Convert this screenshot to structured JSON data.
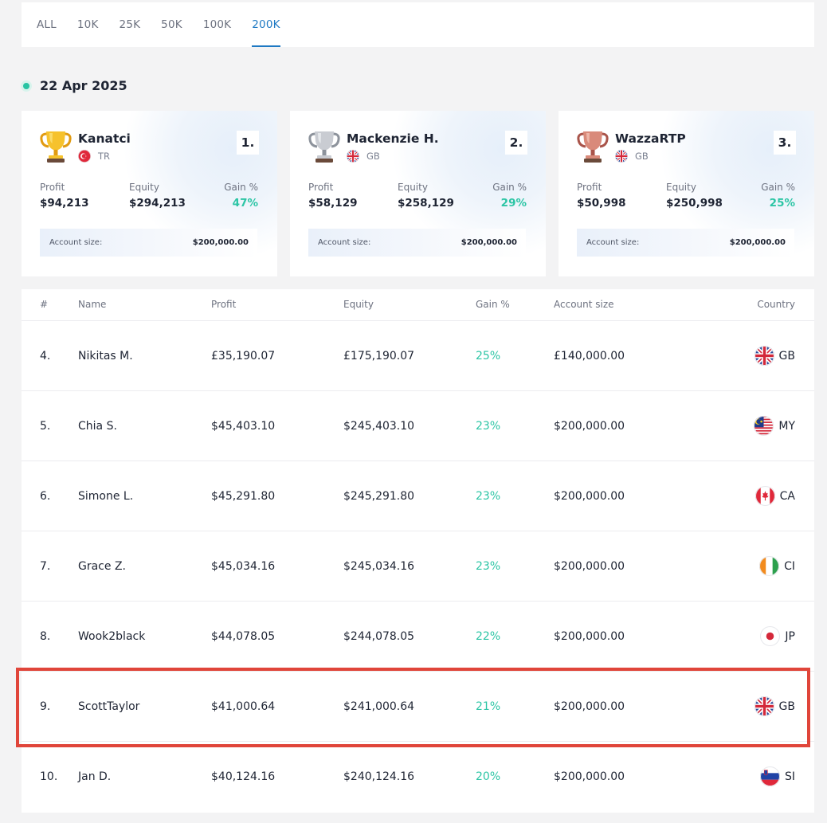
{
  "tabs": [
    {
      "label": "ALL",
      "active": false
    },
    {
      "label": "10K",
      "active": false
    },
    {
      "label": "25K",
      "active": false
    },
    {
      "label": "50K",
      "active": false
    },
    {
      "label": "100K",
      "active": false
    },
    {
      "label": "200K",
      "active": true
    }
  ],
  "date": "22 Apr 2025",
  "podium": [
    {
      "rank": "1.",
      "name": "Kanatci",
      "country": "TR",
      "profit_label": "Profit",
      "profit": "$94,213",
      "equity_label": "Equity",
      "equity": "$294,213",
      "gain_label": "Gain %",
      "gain": "47%",
      "account_label": "Account size:",
      "account": "$200,000.00",
      "trophy": "gold-trophy-icon"
    },
    {
      "rank": "2.",
      "name": "Mackenzie H.",
      "country": "GB",
      "profit_label": "Profit",
      "profit": "$58,129",
      "equity_label": "Equity",
      "equity": "$258,129",
      "gain_label": "Gain %",
      "gain": "29%",
      "account_label": "Account size:",
      "account": "$200,000.00",
      "trophy": "silver-trophy-icon"
    },
    {
      "rank": "3.",
      "name": "WazzaRTP",
      "country": "GB",
      "profit_label": "Profit",
      "profit": "$50,998",
      "equity_label": "Equity",
      "equity": "$250,998",
      "gain_label": "Gain %",
      "gain": "25%",
      "account_label": "Account size:",
      "account": "$200,000.00",
      "trophy": "bronze-trophy-icon"
    }
  ],
  "table": {
    "headers": {
      "rank": "#",
      "name": "Name",
      "profit": "Profit",
      "equity": "Equity",
      "gain": "Gain %",
      "account": "Account size",
      "country": "Country"
    },
    "rows": [
      {
        "rank": "4.",
        "name": "Nikitas M.",
        "profit": "£35,190.07",
        "equity": "£175,190.07",
        "gain": "25%",
        "account": "£140,000.00",
        "country": "GB"
      },
      {
        "rank": "5.",
        "name": "Chia S.",
        "profit": "$45,403.10",
        "equity": "$245,403.10",
        "gain": "23%",
        "account": "$200,000.00",
        "country": "MY"
      },
      {
        "rank": "6.",
        "name": "Simone L.",
        "profit": "$45,291.80",
        "equity": "$245,291.80",
        "gain": "23%",
        "account": "$200,000.00",
        "country": "CA"
      },
      {
        "rank": "7.",
        "name": "Grace Z.",
        "profit": "$45,034.16",
        "equity": "$245,034.16",
        "gain": "23%",
        "account": "$200,000.00",
        "country": "CI"
      },
      {
        "rank": "8.",
        "name": "Wook2black",
        "profit": "$44,078.05",
        "equity": "$244,078.05",
        "gain": "22%",
        "account": "$200,000.00",
        "country": "JP"
      },
      {
        "rank": "9.",
        "name": "ScottTaylor",
        "profit": "$41,000.64",
        "equity": "$241,000.64",
        "gain": "21%",
        "account": "$200,000.00",
        "country": "GB",
        "highlighted": true
      },
      {
        "rank": "10.",
        "name": "Jan D.",
        "profit": "$40,124.16",
        "equity": "$240,124.16",
        "gain": "20%",
        "account": "$200,000.00",
        "country": "SI"
      }
    ]
  },
  "colors": {
    "accent": "#1e79c3",
    "gain": "#2cc5a5",
    "highlight": "#e0453a"
  }
}
